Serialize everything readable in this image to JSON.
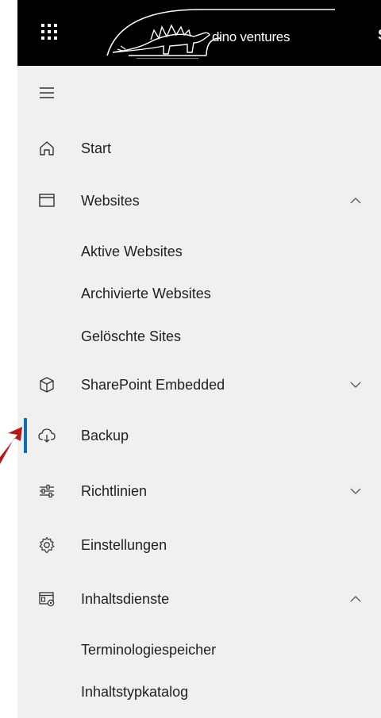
{
  "header": {
    "brand_text": "dino ventures",
    "edge_letter": "S"
  },
  "nav": {
    "menu_toggle": "menu",
    "items": [
      {
        "label": "Start"
      },
      {
        "label": "Websites"
      },
      {
        "label": "SharePoint Embedded"
      },
      {
        "label": "Backup"
      },
      {
        "label": "Richtlinien"
      },
      {
        "label": "Einstellungen"
      },
      {
        "label": "Inhaltsdienste"
      }
    ],
    "websites_sub": [
      "Aktive Websites",
      "Archivierte Websites",
      "Gelöschte Sites"
    ],
    "inhaltsdienste_sub": [
      "Terminologiespeicher",
      "Inhaltstypkatalog"
    ]
  },
  "accent_color": "#0f6cbd",
  "annotation_color": "#b31b1b"
}
